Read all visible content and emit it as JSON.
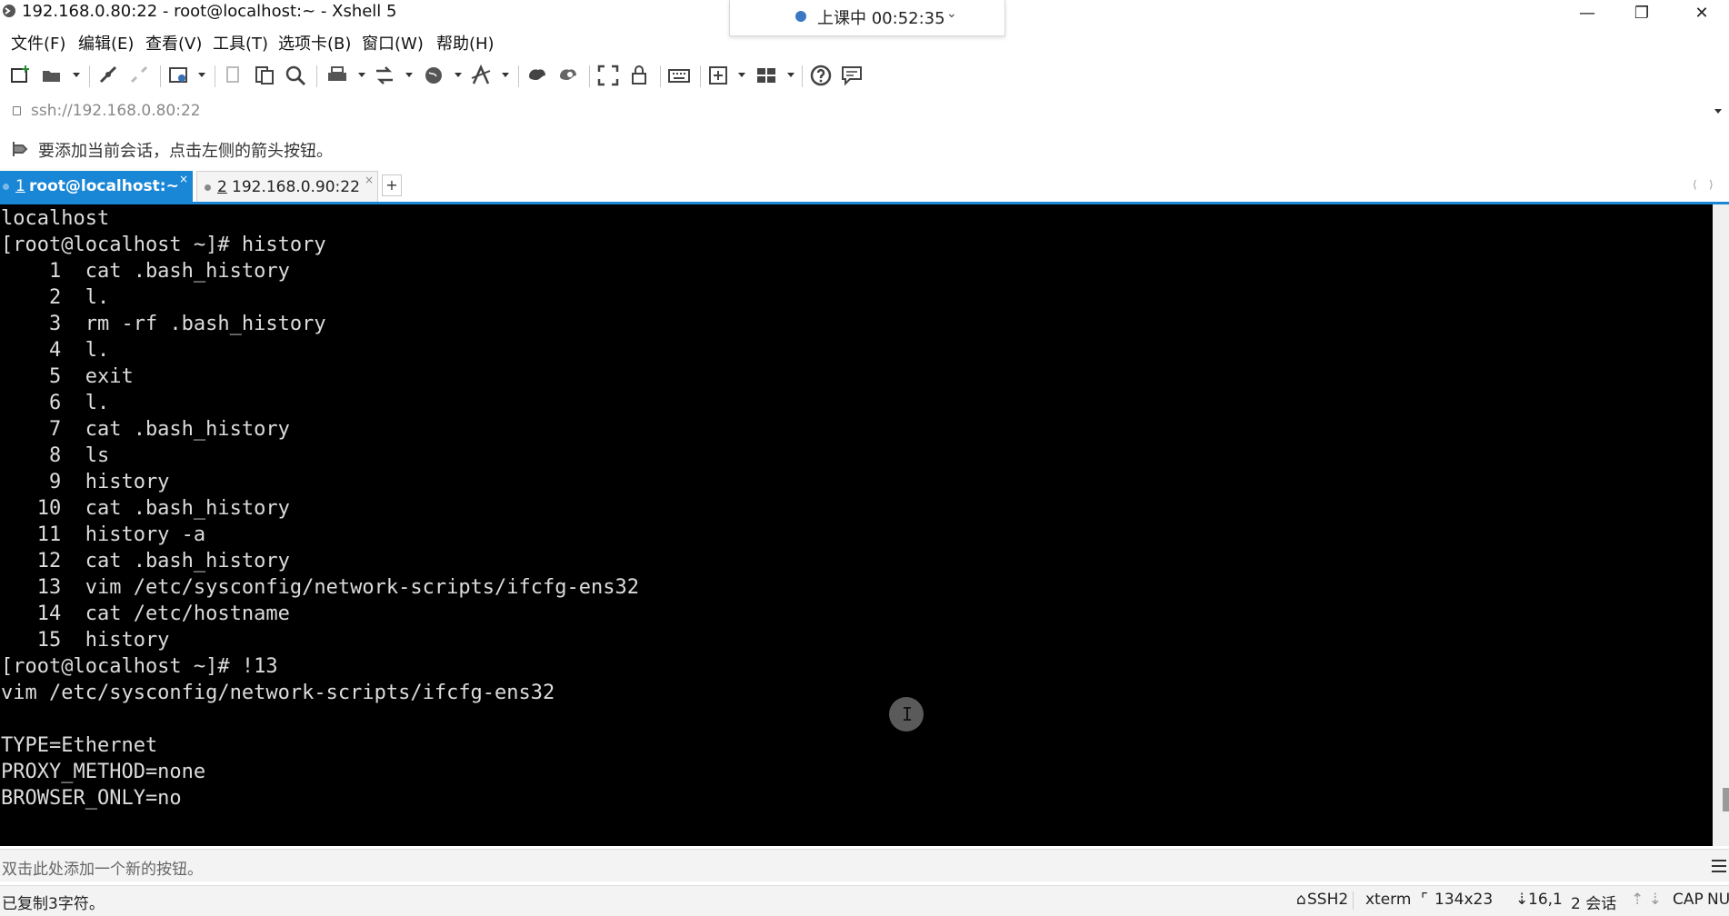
{
  "window": {
    "title": "192.168.0.80:22 - root@localhost:~ - Xshell 5",
    "minimize_glyph": "—",
    "maximize_glyph": "❐",
    "close_glyph": "✕"
  },
  "recording": {
    "label": "上课中 00:52:35",
    "chevron": "⌄"
  },
  "menu": {
    "items": [
      "文件(F)",
      "编辑(E)",
      "查看(V)",
      "工具(T)",
      "选项卡(B)",
      "窗口(W)",
      "帮助(H)"
    ]
  },
  "toolbar": {
    "icons": [
      "new-session-icon",
      "open-folder-icon",
      "reconnect-icon",
      "disconnect-icon",
      "properties-icon",
      "copy-icon",
      "paste-icon",
      "find-icon",
      "print-icon",
      "transfer-icon",
      "globe-icon",
      "font-icon",
      "xftp-icon",
      "xmanager-icon",
      "fullscreen-icon",
      "lock-icon",
      "keyboard-icon",
      "compose-icon",
      "layout-icon",
      "help-icon",
      "chat-icon"
    ]
  },
  "address": {
    "value": "ssh://192.168.0.80:22"
  },
  "hint": {
    "text": "要添加当前会话，点击左侧的箭头按钮。"
  },
  "tabs": [
    {
      "number": "1",
      "label": "root@localhost:~",
      "close": "×"
    },
    {
      "number": "2",
      "label": "192.168.0.90:22",
      "close": "×"
    }
  ],
  "new_tab_label": "+",
  "tab_nav": {
    "left": "⟨",
    "right": "⟩"
  },
  "terminal": {
    "lines": [
      "localhost",
      "[root@localhost ~]# history",
      "    1  cat .bash_history",
      "    2  l.",
      "    3  rm -rf .bash_history",
      "    4  l.",
      "    5  exit",
      "    6  l.",
      "    7  cat .bash_history",
      "    8  ls",
      "    9  history",
      "   10  cat .bash_history",
      "   11  history -a",
      "   12  cat .bash_history",
      "   13  vim /etc/sysconfig/network-scripts/ifcfg-ens32",
      "   14  cat /etc/hostname",
      "   15  history",
      "[root@localhost ~]# !13",
      "vim /etc/sysconfig/network-scripts/ifcfg-ens32",
      "",
      "TYPE=Ethernet",
      "PROXY_METHOD=none",
      "BROWSER_ONLY=no"
    ],
    "cursor_glyph": "I"
  },
  "button_bar": {
    "text": "双击此处添加一个新的按钮。"
  },
  "status": {
    "message": "已复制3字符。",
    "protocol": "SSH2",
    "terminal_type": "xterm",
    "size": "134x23",
    "position": "16,1",
    "sessions": "2 会话",
    "arrows": "⇡ ⇣",
    "cap": "CAP",
    "num": "NU"
  },
  "colors": {
    "tab_active": "#1a87d6",
    "terminal_bg": "#000000",
    "terminal_fg": "#dcdcdc"
  }
}
